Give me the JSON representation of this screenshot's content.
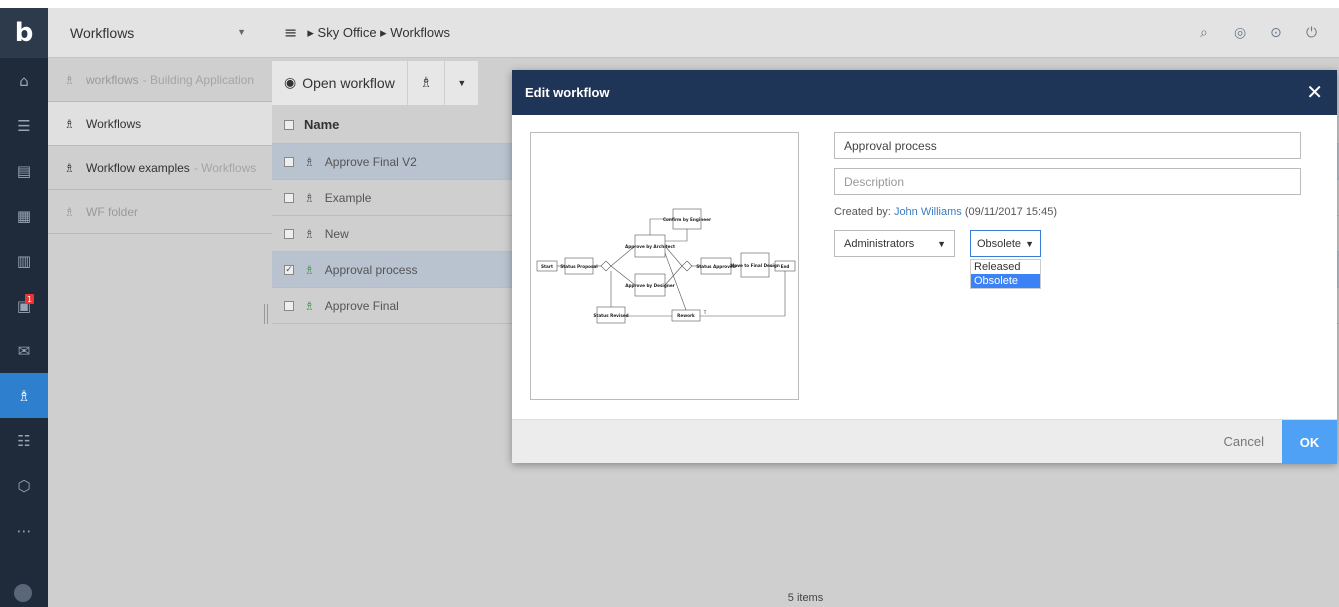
{
  "rail": {
    "logo": "b",
    "items": [
      {
        "icon": "home-icon",
        "glyph": "⌂"
      },
      {
        "icon": "tree-icon",
        "glyph": "☰"
      },
      {
        "icon": "documents-icon",
        "glyph": "▤"
      },
      {
        "icon": "calendar-icon",
        "glyph": "▦"
      },
      {
        "icon": "chart-icon",
        "glyph": "▥"
      },
      {
        "icon": "tasks-icon",
        "glyph": "▣",
        "badge": "1"
      },
      {
        "icon": "mail-icon",
        "glyph": "✉"
      },
      {
        "icon": "workflow-icon",
        "glyph": "♗"
      },
      {
        "icon": "list-icon",
        "glyph": "☷"
      },
      {
        "icon": "package-icon",
        "glyph": "⬡"
      },
      {
        "icon": "more-icon",
        "glyph": "⋯"
      }
    ]
  },
  "left_panel": {
    "title": "Workflows",
    "items": [
      {
        "label": "workflows",
        "sub": "- Building Application"
      },
      {
        "label": "Workflows",
        "sub": ""
      },
      {
        "label": "Workflow examples",
        "sub": "- Workflows"
      },
      {
        "label": "WF folder",
        "sub": ""
      }
    ]
  },
  "breadcrumb": {
    "text": "▸ Sky Office ▸ Workflows"
  },
  "toolbar": {
    "open_label": "Open workflow"
  },
  "grid": {
    "header": "Name",
    "rows": [
      {
        "name": "Approve Final V2",
        "checked": false
      },
      {
        "name": "Example",
        "checked": false
      },
      {
        "name": "New",
        "checked": false
      },
      {
        "name": "Approval process",
        "checked": true
      },
      {
        "name": "Approve Final",
        "checked": false
      }
    ],
    "footer": "5 items"
  },
  "modal": {
    "title": "Edit workflow",
    "name_value": "Approval process",
    "description_placeholder": "Description",
    "created_prefix": "Created by:",
    "created_user": "John Williams",
    "created_date": "(09/11/2017 15:45)",
    "group_select": "Administrators",
    "status_select": "Obsolete",
    "status_options": [
      "Released",
      "Obsolete"
    ],
    "cancel_label": "Cancel",
    "ok_label": "OK",
    "diagram": {
      "start": "Start",
      "status_proposal": "Status Proposal",
      "approve_architect": "Approve by Architect",
      "confirm_engineer": "Confirm by Engineer",
      "approve_designer": "Approve by Designer",
      "status_approved": "Status Approved",
      "move_final": "Move to Final Design",
      "end": "End",
      "status_revised": "Status Revised",
      "rework": "Rework",
      "t_label": "T"
    }
  }
}
